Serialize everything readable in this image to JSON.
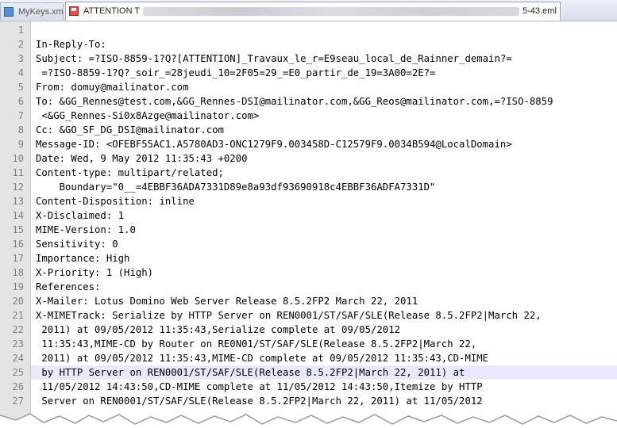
{
  "tabs": [
    {
      "label": "MyKeys.xml",
      "icon": "document-icon"
    },
    {
      "label": "ATTENTION T",
      "label_end": "5-43.eml",
      "icon": "unsaved-file-icon"
    }
  ],
  "editor": {
    "current_line": 25,
    "lines": [
      {
        "n": "1",
        "t": ""
      },
      {
        "n": "2",
        "t": "In-Reply-To:"
      },
      {
        "n": "3",
        "t": "Subject: =?ISO-8859-1?Q?[ATTENTION]_Travaux_le_r=E9seau_local_de_Rainner_demain?="
      },
      {
        "n": "4",
        "t": " =?ISO-8859-1?Q?_soir_=28jeudi_10=2F05=29_=E0_partir_de_19=3A00=2E?="
      },
      {
        "n": "5",
        "t": "From: domuy@mailinator.com"
      },
      {
        "n": "6",
        "t": "To: &GG_Rennes@test.com,&GG_Rennes-DSI@mailinator.com,&GG_Reos@mailinator.com,=?ISO-8859"
      },
      {
        "n": "7",
        "t": " <&GG_Rennes-Si0x8Azge@mailinator.com>"
      },
      {
        "n": "8",
        "t": "Cc: &GO_SF_DG_DSI@mailinator.com"
      },
      {
        "n": "9",
        "t": "Message-ID: <OFEBF55AC1.A5780AD3-ONC1279F9.003458D-C12579F9.0034B594@LocalDomain>"
      },
      {
        "n": "10",
        "t": "Date: Wed, 9 May 2012 11:35:43 +0200"
      },
      {
        "n": "11",
        "t": "Content-type: multipart/related;"
      },
      {
        "n": "12",
        "t": "    Boundary=\"0__=4EBBF36ADA7331D89e8a93df93690918c4EBBF36ADFA7331D\""
      },
      {
        "n": "13",
        "t": "Content-Disposition: inline"
      },
      {
        "n": "14",
        "t": "X-Disclaimed: 1"
      },
      {
        "n": "15",
        "t": "MIME-Version: 1.0"
      },
      {
        "n": "16",
        "t": "Sensitivity: 0"
      },
      {
        "n": "17",
        "t": "Importance: High"
      },
      {
        "n": "18",
        "t": "X-Priority: 1 (High)"
      },
      {
        "n": "19",
        "t": "References:"
      },
      {
        "n": "20",
        "t": "X-Mailer: Lotus Domino Web Server Release 8.5.2FP2 March 22, 2011"
      },
      {
        "n": "21",
        "t": "X-MIMETrack: Serialize by HTTP Server on REN0001/ST/SAF/SLE(Release 8.5.2FP2|March 22,"
      },
      {
        "n": "22",
        "t": " 2011) at 09/05/2012 11:35:43,Serialize complete at 09/05/2012"
      },
      {
        "n": "23",
        "t": " 11:35:43,MIME-CD by Router on RE0N01/ST/SAF/SLE(Release 8.5.2FP2|March 22,"
      },
      {
        "n": "24",
        "t": " 2011) at 09/05/2012 11:35:43,MIME-CD complete at 09/05/2012 11:35:43,CD-MIME"
      },
      {
        "n": "25",
        "t": " by HTTP Server on REN0001/ST/SAF/SLE(Release 8.5.2FP2|March 22, 2011) at"
      },
      {
        "n": "26",
        "t": " 11/05/2012 14:43:50,CD-MIME complete at 11/05/2012 14:43:50,Itemize by HTTP"
      },
      {
        "n": "27",
        "t": " Server on REN0001/ST/SAF/SLE(Release 8.5.2FP2|March 22, 2011) at 11/05/2012"
      }
    ]
  },
  "colors": {
    "gutter": "#e4e4e4",
    "current_line": "#e8e8ff",
    "line_number": "#7f7f7f",
    "text": "#000000"
  }
}
